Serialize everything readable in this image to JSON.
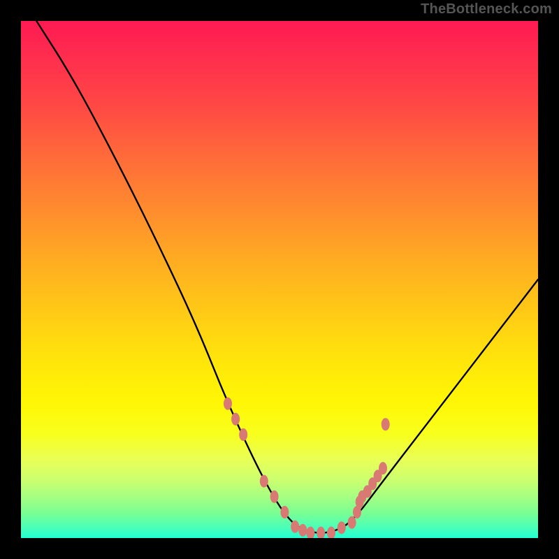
{
  "watermark": "TheBottleneck.com",
  "chart_data": {
    "type": "line",
    "title": "",
    "xlabel": "",
    "ylabel": "",
    "xlim": [
      0,
      100
    ],
    "ylim": [
      0,
      100
    ],
    "background_gradient": {
      "top": "#ff1a52",
      "middle": "#ffe60a",
      "bottom": "#22ffd4"
    },
    "series": [
      {
        "name": "main-curve",
        "color": "#000000",
        "x": [
          3,
          10,
          18,
          26,
          34,
          40,
          47,
          52,
          56,
          60,
          64,
          70,
          80,
          90,
          100
        ],
        "y": [
          100,
          89,
          74,
          58,
          41,
          26,
          11,
          3,
          1,
          1,
          3,
          11,
          24,
          37,
          50
        ]
      }
    ],
    "highlight_points": {
      "name": "threshold-markers",
      "color": "#d87a73",
      "x": [
        40,
        41.5,
        43,
        47,
        49,
        51,
        53,
        54.5,
        56,
        58,
        60,
        62,
        64,
        65,
        65.5,
        66,
        67,
        68,
        69,
        70,
        70.5
      ],
      "y": [
        26,
        23,
        20,
        11,
        8,
        5,
        2.2,
        1.5,
        1,
        1,
        1,
        2,
        3,
        5,
        7,
        8,
        9,
        10.5,
        12,
        13.5,
        22
      ]
    }
  }
}
